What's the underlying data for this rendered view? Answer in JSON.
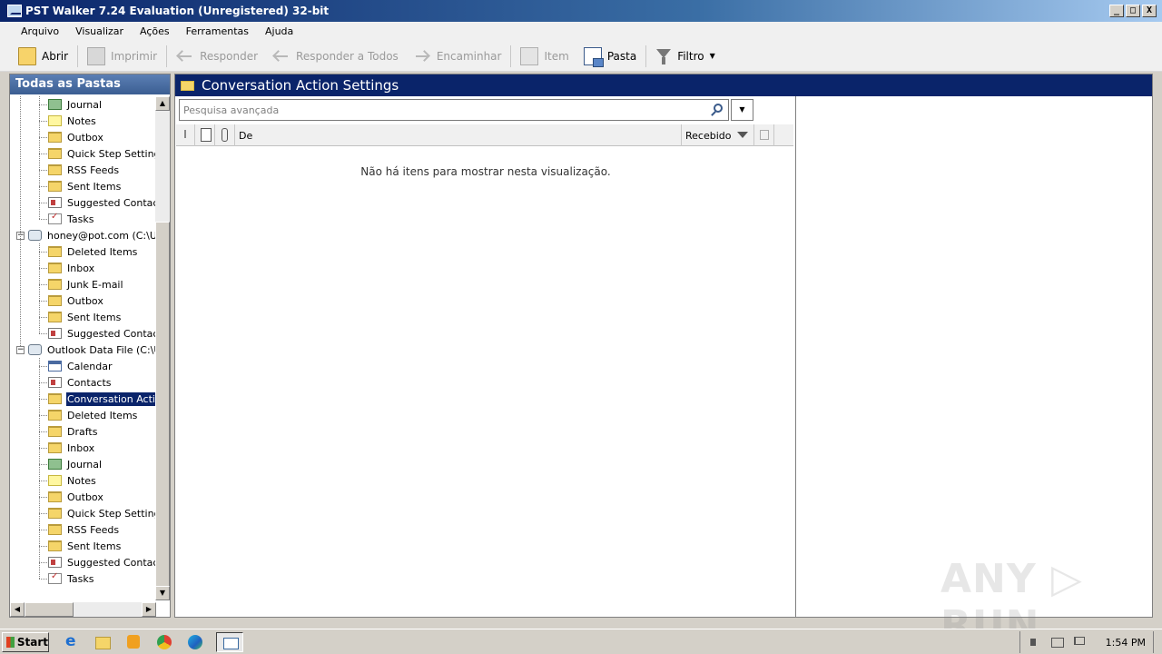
{
  "window": {
    "title": "PST Walker 7.24 Evaluation (Unregistered) 32-bit",
    "minimize": "_",
    "maximize": "□",
    "close": "X"
  },
  "menu": [
    "Arquivo",
    "Visualizar",
    "Ações",
    "Ferramentas",
    "Ajuda"
  ],
  "toolbar": {
    "open": "Abrir",
    "print": "Imprimir",
    "reply": "Responder",
    "reply_all": "Responder a Todos",
    "forward": "Encaminhar",
    "item": "Item",
    "folder": "Pasta",
    "filter": "Filtro",
    "filter_arrow": "▼"
  },
  "left_pane": {
    "header": "Todas as Pastas",
    "tree": [
      {
        "label": "Journal",
        "icon": "journal-icon",
        "level": 2
      },
      {
        "label": "Notes",
        "icon": "notes-icon",
        "level": 2
      },
      {
        "label": "Outbox",
        "icon": "folder-icon",
        "level": 2
      },
      {
        "label": "Quick Step Settings",
        "icon": "folder-icon",
        "level": 2
      },
      {
        "label": "RSS Feeds",
        "icon": "folder-icon",
        "level": 2
      },
      {
        "label": "Sent Items",
        "icon": "folder-icon",
        "level": 2
      },
      {
        "label": "Suggested Contacts",
        "icon": "contacts-icon",
        "level": 2
      },
      {
        "label": "Tasks",
        "icon": "tasks-icon",
        "level": 2
      },
      {
        "label": "honey@pot.com (C:\\Use",
        "icon": "account-icon",
        "level": 1
      },
      {
        "label": "Deleted Items",
        "icon": "folder-icon",
        "level": 2
      },
      {
        "label": "Inbox",
        "icon": "folder-icon",
        "level": 2
      },
      {
        "label": "Junk E-mail",
        "icon": "folder-icon",
        "level": 2
      },
      {
        "label": "Outbox",
        "icon": "folder-icon",
        "level": 2
      },
      {
        "label": "Sent Items",
        "icon": "folder-icon",
        "level": 2
      },
      {
        "label": "Suggested Contacts",
        "icon": "contacts-icon",
        "level": 2
      },
      {
        "label": "Outlook Data File (C:\\Us",
        "icon": "account-icon",
        "level": 1
      },
      {
        "label": "Calendar",
        "icon": "calendar-icon",
        "level": 2
      },
      {
        "label": "Contacts",
        "icon": "contacts-icon",
        "level": 2
      },
      {
        "label": "Conversation Action",
        "icon": "folder-icon",
        "level": 2,
        "selected": true
      },
      {
        "label": "Deleted Items",
        "icon": "folder-icon",
        "level": 2
      },
      {
        "label": "Drafts",
        "icon": "folder-icon",
        "level": 2
      },
      {
        "label": "Inbox",
        "icon": "folder-icon",
        "level": 2
      },
      {
        "label": "Journal",
        "icon": "journal-icon",
        "level": 2
      },
      {
        "label": "Notes",
        "icon": "notes-icon",
        "level": 2
      },
      {
        "label": "Outbox",
        "icon": "folder-icon",
        "level": 2
      },
      {
        "label": "Quick Step Settings",
        "icon": "folder-icon",
        "level": 2
      },
      {
        "label": "RSS Feeds",
        "icon": "folder-icon",
        "level": 2
      },
      {
        "label": "Sent Items",
        "icon": "folder-icon",
        "level": 2
      },
      {
        "label": "Suggested Contacts",
        "icon": "contacts-icon",
        "level": 2
      },
      {
        "label": "Tasks",
        "icon": "tasks-icon",
        "level": 2
      }
    ],
    "expander_symbol": "−",
    "scroll_up": "▲",
    "scroll_down": "▼",
    "scroll_left": "◀",
    "scroll_right": "▶"
  },
  "right_pane": {
    "header": "Conversation Action Settings",
    "search_placeholder": "Pesquisa avançada",
    "search_dropdown": "▼",
    "columns": {
      "from": "De",
      "received": "Recebido"
    },
    "empty_message": "Não há itens para mostrar nesta visualização."
  },
  "taskbar": {
    "start": "Start",
    "clock": "1:54 PM"
  },
  "watermark": "ANY ▷ RUN"
}
